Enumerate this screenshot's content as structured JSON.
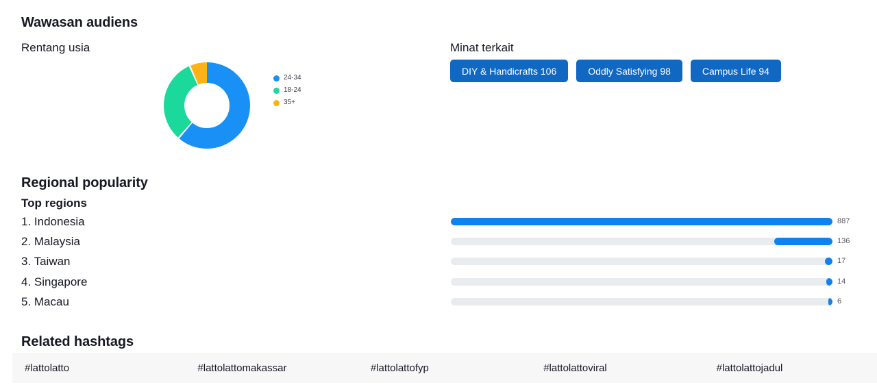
{
  "section_audience": {
    "title": "Wawasan audiens",
    "age_title": "Rentang usia",
    "interests_title": "Minat terkait"
  },
  "section_regional": {
    "title": "Regional popularity",
    "subtitle": "Top regions"
  },
  "section_hashtags": {
    "title": "Related hashtags",
    "items": [
      {
        "tag": "#lattolatto"
      },
      {
        "tag": "#lattolattomakassar"
      },
      {
        "tag": "#lattolattofyp"
      },
      {
        "tag": "#lattolattoviral"
      },
      {
        "tag": "#lattolattojadul"
      }
    ]
  },
  "interests": [
    {
      "label": "DIY & Handicrafts 106"
    },
    {
      "label": "Oddly Satisfying 98"
    },
    {
      "label": "Campus Life 94"
    }
  ],
  "colors": {
    "age_24_34": "#1890f5",
    "age_18_24": "#1ad99a",
    "age_35_plus": "#fcb315",
    "tag_blue": "#1068c3",
    "bar_blue": "#0d82f0",
    "bar_track": "#e9ecef",
    "strip_bg": "#f7f7f7"
  },
  "chart_data": [
    {
      "type": "pie",
      "title": "Rentang usia",
      "variant": "donut",
      "legend_position": "right",
      "categories": [
        "24-34",
        "18-24",
        "35+"
      ],
      "values": [
        61,
        32,
        7
      ],
      "unit": "percent",
      "colors": [
        "#1890f5",
        "#1ad99a",
        "#fcb315"
      ],
      "legend": [
        {
          "label": "24-34",
          "color": "#1890f5"
        },
        {
          "label": "18-24",
          "color": "#1ad99a"
        },
        {
          "label": "35+",
          "color": "#fcb315"
        }
      ]
    },
    {
      "type": "bar",
      "orientation": "horizontal",
      "title": "Top regions",
      "xlabel": "",
      "ylabel": "",
      "grid": false,
      "align": "right",
      "categories": [
        "Indonesia",
        "Malaysia",
        "Taiwan",
        "Singapore",
        "Macau"
      ],
      "values": [
        887,
        136,
        17,
        14,
        6
      ],
      "xlim": [
        0,
        887
      ],
      "rows": [
        {
          "rank": "1.",
          "name": "Indonesia",
          "value": 887,
          "label": "887"
        },
        {
          "rank": "2.",
          "name": "Malaysia",
          "value": 136,
          "label": "136"
        },
        {
          "rank": "3.",
          "name": "Taiwan",
          "value": 17,
          "label": "17"
        },
        {
          "rank": "4.",
          "name": "Singapore",
          "value": 14,
          "label": "14"
        },
        {
          "rank": "5.",
          "name": "Macau",
          "value": 6,
          "label": "6"
        }
      ]
    }
  ]
}
